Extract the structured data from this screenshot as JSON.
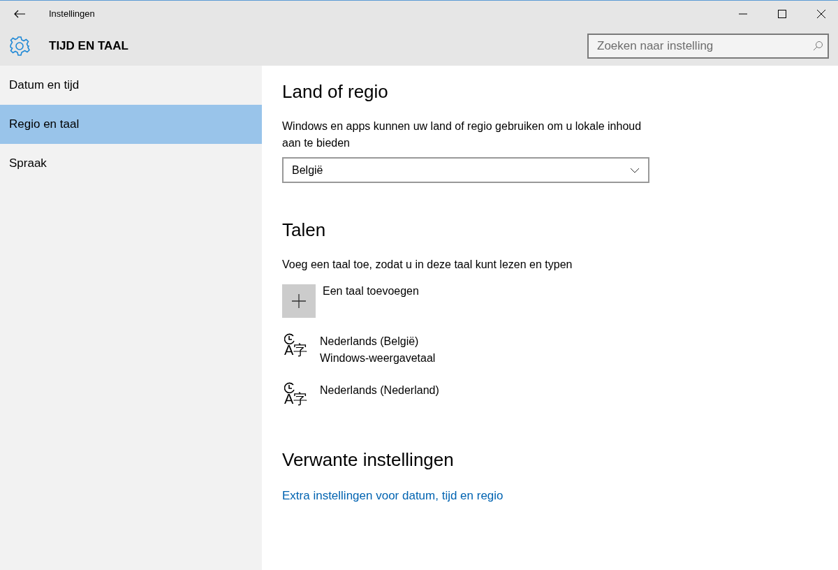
{
  "window": {
    "title": "Instellingen"
  },
  "header": {
    "title": "TIJD EN TAAL",
    "search": {
      "placeholder": "Zoeken naar instelling"
    }
  },
  "sidebar": {
    "items": [
      {
        "label": "Datum en tijd",
        "selected": false
      },
      {
        "label": "Regio en taal",
        "selected": true
      },
      {
        "label": "Spraak",
        "selected": false
      }
    ]
  },
  "region": {
    "heading": "Land of regio",
    "description": "Windows en apps kunnen uw land of regio gebruiken om u lokale inhoud aan te bieden",
    "dropdown": {
      "value": "België"
    }
  },
  "languages": {
    "heading": "Talen",
    "description": "Voeg een taal toe, zodat u in deze taal kunt lezen en typen",
    "add_label": "Een taal toevoegen",
    "items": [
      {
        "icon_text": "A字",
        "name": "Nederlands (België)",
        "subtitle": "Windows-weergavetaal"
      },
      {
        "icon_text": "A字",
        "name": "Nederlands (Nederland)"
      }
    ]
  },
  "related": {
    "heading": "Verwante instellingen",
    "link": "Extra instellingen voor datum, tijd en regio"
  }
}
